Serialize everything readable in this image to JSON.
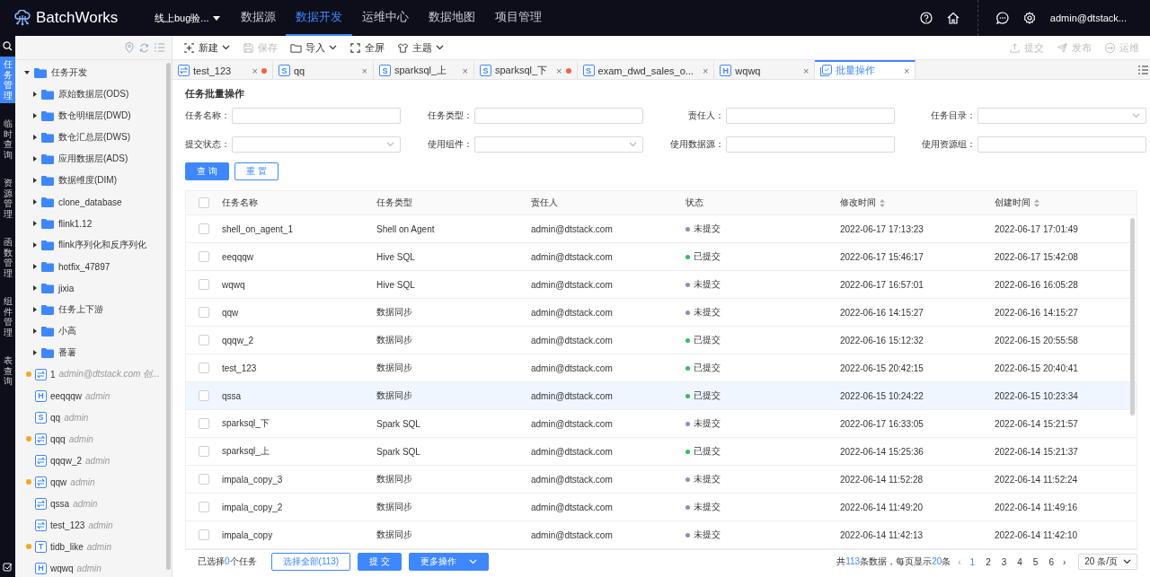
{
  "header": {
    "brand": "BatchWorks",
    "project": "线上bug验...",
    "nav": [
      {
        "label": "数据源",
        "selected": false
      },
      {
        "label": "数据开发",
        "selected": true
      },
      {
        "label": "运维中心",
        "selected": false
      },
      {
        "label": "数据地图",
        "selected": false
      },
      {
        "label": "项目管理",
        "selected": false
      }
    ],
    "user": "admin@dtstack..."
  },
  "rail": {
    "tabs": [
      {
        "label": "任务管理",
        "selected": true
      },
      {
        "label": "临时查询",
        "selected": false
      },
      {
        "label": "资源管理",
        "selected": false
      },
      {
        "label": "函数管理",
        "selected": false
      },
      {
        "label": "组件管理",
        "selected": false
      },
      {
        "label": "表查询",
        "selected": false
      }
    ]
  },
  "tree": {
    "root": {
      "label": "任务开发",
      "expanded": true,
      "children": [
        {
          "kind": "folder",
          "label": "原始数据层(ODS)"
        },
        {
          "kind": "folder",
          "label": "数仓明细层(DWD)"
        },
        {
          "kind": "folder",
          "label": "数仓汇总层(DWS)"
        },
        {
          "kind": "folder",
          "label": "应用数据层(ADS)"
        },
        {
          "kind": "folder",
          "label": "数据维度(DIM)"
        },
        {
          "kind": "folder",
          "label": "clone_database"
        },
        {
          "kind": "folder",
          "label": "flink1.12"
        },
        {
          "kind": "folder",
          "label": "flink序列化和反序列化"
        },
        {
          "kind": "folder",
          "label": "hotfix_47897"
        },
        {
          "kind": "folder",
          "label": "jixia"
        },
        {
          "kind": "folder",
          "label": "任务上下游"
        },
        {
          "kind": "folder",
          "label": "小高"
        },
        {
          "kind": "folder",
          "label": "番薯"
        },
        {
          "kind": "sync",
          "label": "1",
          "owner": "admin@dtstack.com 创...",
          "modified": true
        },
        {
          "kind": "hive",
          "badge": "H",
          "label": "eeqqqw",
          "owner": "admin",
          "modified": false
        },
        {
          "kind": "spark",
          "badge": "S",
          "label": "qq",
          "owner": "admin",
          "modified": false
        },
        {
          "kind": "sync",
          "label": "qqq",
          "owner": "admin",
          "modified": true
        },
        {
          "kind": "sync",
          "label": "qqqw_2",
          "owner": "admin",
          "modified": false
        },
        {
          "kind": "sync",
          "label": "qqw",
          "owner": "admin",
          "modified": true
        },
        {
          "kind": "sync",
          "label": "qssa",
          "owner": "admin",
          "modified": false
        },
        {
          "kind": "sync",
          "label": "test_123",
          "owner": "admin",
          "modified": false
        },
        {
          "kind": "tidb",
          "badge": "T",
          "label": "tidb_like",
          "owner": "admin",
          "modified": true
        },
        {
          "kind": "hive",
          "badge": "H",
          "label": "wqwq",
          "owner": "admin",
          "modified": false
        }
      ]
    }
  },
  "toolbar": {
    "left": [
      {
        "kind": "new",
        "label": "新建",
        "disabled": false,
        "dropdown": true
      },
      {
        "kind": "save",
        "label": "保存",
        "disabled": true,
        "dropdown": false
      },
      {
        "kind": "import",
        "label": "导入",
        "disabled": false,
        "dropdown": true
      },
      {
        "kind": "fullscreen",
        "label": "全屏",
        "disabled": false,
        "dropdown": false
      },
      {
        "kind": "theme",
        "label": "主题",
        "disabled": false,
        "dropdown": true
      }
    ],
    "right": [
      {
        "kind": "submit",
        "label": "提交",
        "disabled": true
      },
      {
        "kind": "publish",
        "label": "发布",
        "disabled": true
      },
      {
        "kind": "ops",
        "label": "运维",
        "disabled": true
      }
    ]
  },
  "tabs": [
    {
      "kind": "sync",
      "label": "test_123",
      "close": "×",
      "modified": true,
      "selected": false
    },
    {
      "kind": "spark",
      "badge": "S",
      "label": "qq",
      "close": "×",
      "modified": false,
      "selected": false
    },
    {
      "kind": "spark",
      "badge": "S",
      "label": "sparksql_上",
      "close": "×",
      "modified": false,
      "selected": false
    },
    {
      "kind": "spark",
      "badge": "S",
      "label": "sparksql_下",
      "close": "×",
      "modified": true,
      "selected": false
    },
    {
      "kind": "spark",
      "badge": "S",
      "label": "exam_dwd_sales_o...",
      "close": "×",
      "modified": false,
      "selected": false
    },
    {
      "kind": "hive",
      "badge": "H",
      "label": "wqwq",
      "close": "×",
      "modified": false,
      "selected": false
    },
    {
      "kind": "batch",
      "label": "批量操作",
      "close": "×",
      "modified": false,
      "selected": true
    }
  ],
  "panel": {
    "title": "任务批量操作",
    "filters": [
      {
        "label": "任务名称：",
        "kind": "input"
      },
      {
        "label": "任务类型：",
        "kind": "input"
      },
      {
        "label": "责任人：",
        "kind": "input"
      },
      {
        "label": "任务目录：",
        "kind": "select"
      },
      {
        "label": "提交状态：",
        "kind": "select"
      },
      {
        "label": "使用组件：",
        "kind": "select"
      },
      {
        "label": "使用数据源：",
        "kind": "input"
      },
      {
        "label": "使用资源组：",
        "kind": "input"
      }
    ],
    "query_button": "查 询",
    "reset_button": "重 置"
  },
  "table": {
    "all_checked": false,
    "columns": [
      {
        "label": "任务名称",
        "sortable": false
      },
      {
        "label": "任务类型",
        "sortable": false
      },
      {
        "label": "责任人",
        "sortable": false
      },
      {
        "label": "状态",
        "sortable": false
      },
      {
        "label": "修改时间",
        "sortable": true
      },
      {
        "label": "创建时间",
        "sortable": true
      }
    ],
    "rows": [
      {
        "checked": false,
        "selected": false,
        "name": "shell_on_agent_1",
        "type": "Shell on Agent",
        "owner": "admin@dtstack.com",
        "status": "未提交",
        "color": "#8c8fb8",
        "modified": "2022-06-17 17:13:23",
        "created": "2022-06-17 17:01:49"
      },
      {
        "checked": false,
        "selected": false,
        "name": "eeqqqw",
        "type": "Hive SQL",
        "owner": "admin@dtstack.com",
        "status": "已提交",
        "color": "#2fbf5b",
        "modified": "2022-06-17 15:46:17",
        "created": "2022-06-17 15:42:08"
      },
      {
        "checked": false,
        "selected": false,
        "name": "wqwq",
        "type": "Hive SQL",
        "owner": "admin@dtstack.com",
        "status": "未提交",
        "color": "#8c8fb8",
        "modified": "2022-06-17 16:57:01",
        "created": "2022-06-16 16:05:28"
      },
      {
        "checked": false,
        "selected": false,
        "name": "qqw",
        "type": "数据同步",
        "owner": "admin@dtstack.com",
        "status": "未提交",
        "color": "#8c8fb8",
        "modified": "2022-06-16 14:15:27",
        "created": "2022-06-16 14:15:27"
      },
      {
        "checked": false,
        "selected": false,
        "name": "qqqw_2",
        "type": "数据同步",
        "owner": "admin@dtstack.com",
        "status": "已提交",
        "color": "#2fbf5b",
        "modified": "2022-06-16 15:12:32",
        "created": "2022-06-15 20:55:58"
      },
      {
        "checked": false,
        "selected": false,
        "name": "test_123",
        "type": "数据同步",
        "owner": "admin@dtstack.com",
        "status": "已提交",
        "color": "#2fbf5b",
        "modified": "2022-06-15 20:42:15",
        "created": "2022-06-15 20:40:41"
      },
      {
        "checked": false,
        "selected": true,
        "name": "qssa",
        "type": "数据同步",
        "owner": "admin@dtstack.com",
        "status": "已提交",
        "color": "#2fbf5b",
        "modified": "2022-06-15 10:24:22",
        "created": "2022-06-15 10:23:34"
      },
      {
        "checked": false,
        "selected": false,
        "name": "sparksql_下",
        "type": "Spark SQL",
        "owner": "admin@dtstack.com",
        "status": "未提交",
        "color": "#8c8fb8",
        "modified": "2022-06-17 16:33:05",
        "created": "2022-06-14 15:21:57"
      },
      {
        "checked": false,
        "selected": false,
        "name": "sparksql_上",
        "type": "Spark SQL",
        "owner": "admin@dtstack.com",
        "status": "已提交",
        "color": "#2fbf5b",
        "modified": "2022-06-14 15:25:36",
        "created": "2022-06-14 15:21:37"
      },
      {
        "checked": false,
        "selected": false,
        "name": "impala_copy_3",
        "type": "数据同步",
        "owner": "admin@dtstack.com",
        "status": "未提交",
        "color": "#8c8fb8",
        "modified": "2022-06-14 11:52:28",
        "created": "2022-06-14 11:52:24"
      },
      {
        "checked": false,
        "selected": false,
        "name": "impala_copy_2",
        "type": "数据同步",
        "owner": "admin@dtstack.com",
        "status": "未提交",
        "color": "#8c8fb8",
        "modified": "2022-06-14 11:49:20",
        "created": "2022-06-14 11:49:16"
      },
      {
        "checked": false,
        "selected": false,
        "name": "impala_copy",
        "type": "数据同步",
        "owner": "admin@dtstack.com",
        "status": "未提交",
        "color": "#8c8fb8",
        "modified": "2022-06-14 11:42:13",
        "created": "2022-06-14 11:42:10"
      }
    ]
  },
  "footer": {
    "selected_info": "已选择**0**个任务",
    "select_all": "选择全部(113)",
    "submit": "提 交",
    "more": "更多操作",
    "total": "共**113**条数据，每页显示**20**条",
    "prev": "‹",
    "next": "›",
    "pages": [
      {
        "label": "1",
        "selected": true
      },
      {
        "label": "2",
        "selected": false
      },
      {
        "label": "3",
        "selected": false
      },
      {
        "label": "4",
        "selected": false
      },
      {
        "label": "5",
        "selected": false
      },
      {
        "label": "6",
        "selected": false
      }
    ],
    "page_size": "20 条/页"
  }
}
